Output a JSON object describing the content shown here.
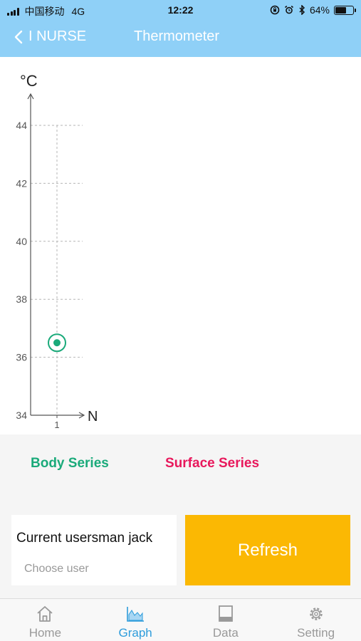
{
  "status_bar": {
    "carrier": "中国移动",
    "network": "4G",
    "time": "12:22",
    "battery_percent": "64%",
    "battery_level": 0.64,
    "icons": [
      "signal-icon",
      "rotation-lock-icon",
      "alarm-icon",
      "bluetooth-icon",
      "battery-icon"
    ]
  },
  "nav": {
    "back_label": "I NURSE",
    "title": "Thermometer"
  },
  "chart_data": {
    "type": "scatter",
    "ylabel": "°C",
    "xlabel": "N",
    "ylim": [
      34,
      44
    ],
    "yticks": [
      "34",
      "36",
      "38",
      "40",
      "42",
      "44"
    ],
    "xticks": [
      "1"
    ],
    "grid": true,
    "series": [
      {
        "name": "Body Series",
        "color": "#1aaa7a",
        "points": [
          {
            "x": 1,
            "y": 36.5
          }
        ]
      }
    ]
  },
  "legend": {
    "body": {
      "label": "Body Series",
      "color": "#1aaa7a"
    },
    "surface": {
      "label": "Surface Series",
      "color": "#e8185c"
    }
  },
  "user": {
    "current": "Current usersman jack",
    "choose": "Choose user"
  },
  "refresh_label": "Refresh",
  "colors": {
    "header": "#8fd0f7",
    "accent_blue": "#2d9cdb",
    "refresh": "#fbb803"
  },
  "tabs": [
    {
      "label": "Home",
      "icon": "home-icon",
      "active": false
    },
    {
      "label": "Graph",
      "icon": "graph-icon",
      "active": true
    },
    {
      "label": "Data",
      "icon": "book-icon",
      "active": false
    },
    {
      "label": "Setting",
      "icon": "gear-icon",
      "active": false
    }
  ]
}
